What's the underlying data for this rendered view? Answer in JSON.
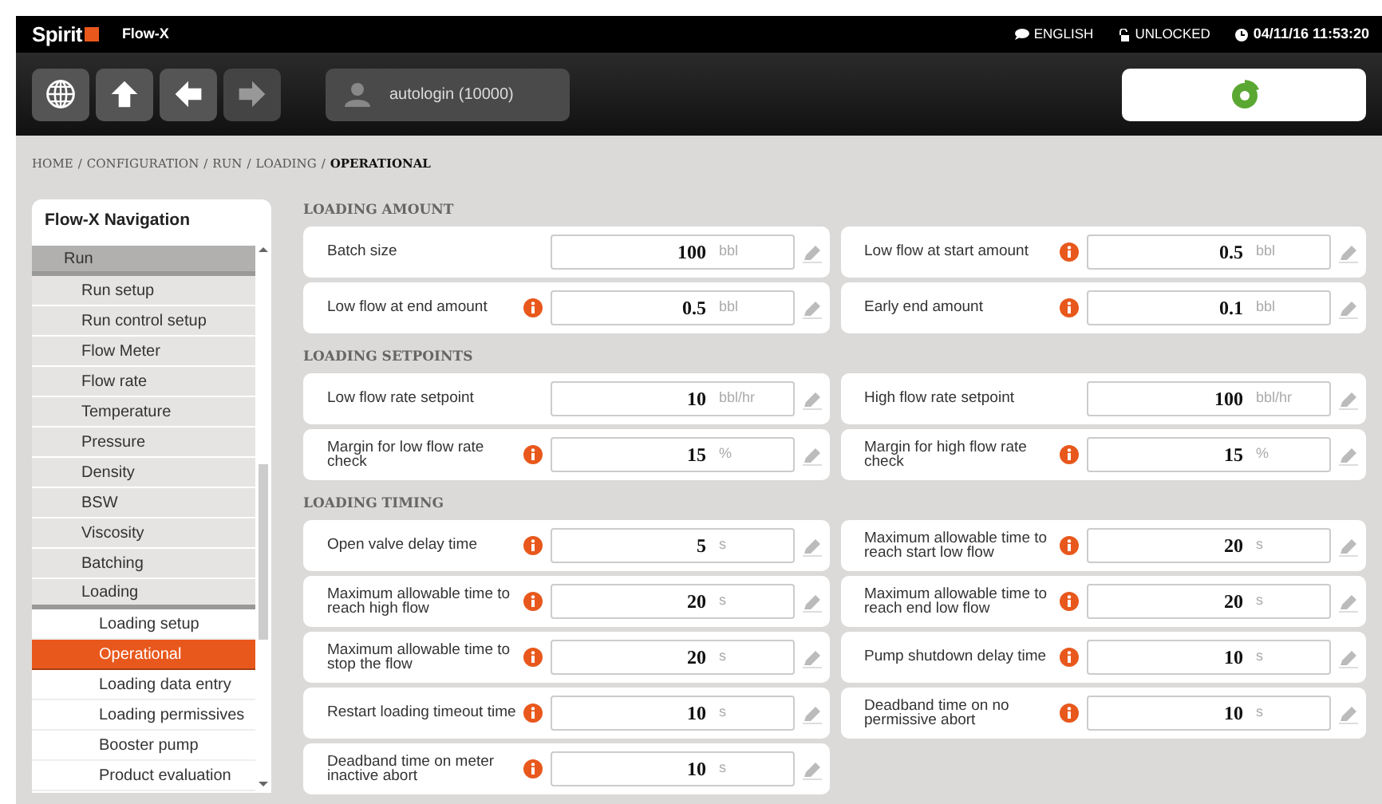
{
  "header": {
    "logo": "Spirit",
    "product": "Flow-X",
    "language": "ENGLISH",
    "lock": "UNLOCKED",
    "datetime": "04/11/16 11:53:20"
  },
  "toolbar": {
    "buttons": [
      {
        "kind": "globe",
        "disabled": false
      },
      {
        "kind": "up",
        "disabled": false
      },
      {
        "kind": "back",
        "disabled": false
      },
      {
        "kind": "forward",
        "disabled": true
      }
    ],
    "user": "autologin (10000)"
  },
  "breadcrumb": [
    {
      "kind": "link",
      "text": "HOME"
    },
    {
      "kind": "separator",
      "text": "/"
    },
    {
      "kind": "link",
      "text": "CONFIGURATION"
    },
    {
      "kind": "separator",
      "text": "/"
    },
    {
      "kind": "link",
      "text": "RUN"
    },
    {
      "kind": "separator",
      "text": "/"
    },
    {
      "kind": "link",
      "text": "LOADING"
    },
    {
      "kind": "separator",
      "text": "/"
    },
    {
      "kind": "current",
      "text": "OPERATIONAL"
    }
  ],
  "sidebar": {
    "title": "Flow-X Navigation",
    "items": [
      {
        "label": "Run",
        "expanded": true,
        "selected": false,
        "children": [
          {
            "label": "Run setup",
            "selected": false
          },
          {
            "label": "Run control setup",
            "selected": false
          },
          {
            "label": "Flow Meter",
            "selected": false
          },
          {
            "label": "Flow rate",
            "selected": false
          },
          {
            "label": "Temperature",
            "selected": false
          },
          {
            "label": "Pressure",
            "selected": false
          },
          {
            "label": "Density",
            "selected": false
          },
          {
            "label": "BSW",
            "selected": false
          },
          {
            "label": "Viscosity",
            "selected": false
          },
          {
            "label": "Batching",
            "selected": false
          },
          {
            "label": "Loading",
            "expanded": true,
            "selected": false,
            "children": [
              {
                "label": "Loading setup",
                "selected": false
              },
              {
                "label": "Operational",
                "selected": true
              },
              {
                "label": "Loading data entry",
                "selected": false
              },
              {
                "label": "Loading permissives",
                "selected": false
              },
              {
                "label": "Booster pump",
                "selected": false
              },
              {
                "label": "Product evaluation",
                "selected": false
              }
            ]
          }
        ]
      }
    ]
  },
  "sections": [
    {
      "title": "LOADING AMOUNT",
      "fields": [
        {
          "label": "Batch size",
          "info": false,
          "value": "100",
          "unit": "bbl"
        },
        {
          "label": "Low flow at start amount",
          "info": true,
          "value": "0.5",
          "unit": "bbl"
        },
        {
          "label": "Low flow at end amount",
          "info": true,
          "value": "0.5",
          "unit": "bbl"
        },
        {
          "label": "Early end amount",
          "info": true,
          "value": "0.1",
          "unit": "bbl"
        }
      ]
    },
    {
      "title": "LOADING SETPOINTS",
      "fields": [
        {
          "label": "Low flow rate setpoint",
          "info": false,
          "value": "10",
          "unit": "bbl/hr"
        },
        {
          "label": "High flow rate setpoint",
          "info": false,
          "value": "100",
          "unit": "bbl/hr"
        },
        {
          "label": "Margin for low flow rate check",
          "info": true,
          "value": "15",
          "unit": "%"
        },
        {
          "label": "Margin for high flow rate check",
          "info": true,
          "value": "15",
          "unit": "%"
        }
      ]
    },
    {
      "title": "LOADING TIMING",
      "fields": [
        {
          "label": "Open valve delay time",
          "info": true,
          "value": "5",
          "unit": "s"
        },
        {
          "label": "Maximum allowable time to reach start low flow",
          "info": true,
          "value": "20",
          "unit": "s"
        },
        {
          "label": "Maximum allowable time to reach high flow",
          "info": true,
          "value": "20",
          "unit": "s"
        },
        {
          "label": "Maximum allowable time to reach end low flow",
          "info": true,
          "value": "20",
          "unit": "s"
        },
        {
          "label": "Maximum allowable time to stop the flow",
          "info": true,
          "value": "20",
          "unit": "s"
        },
        {
          "label": "Pump shutdown delay time",
          "info": true,
          "value": "10",
          "unit": "s"
        },
        {
          "label": "Restart loading timeout time",
          "info": true,
          "value": "10",
          "unit": "s"
        },
        {
          "label": "Deadband time on no permissive abort",
          "info": true,
          "value": "10",
          "unit": "s"
        },
        {
          "label": "Deadband time on meter inactive abort",
          "info": true,
          "value": "10",
          "unit": "s"
        }
      ]
    }
  ]
}
